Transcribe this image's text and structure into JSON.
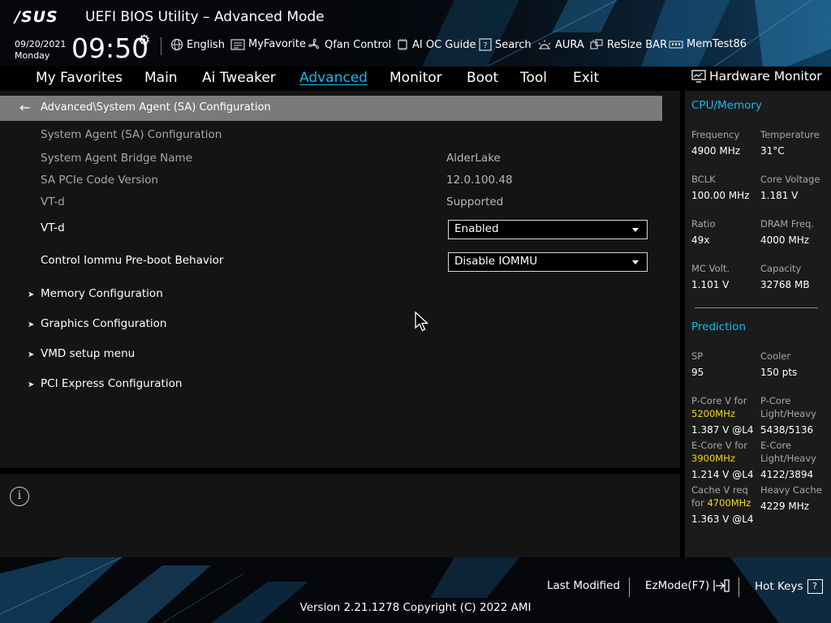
{
  "header": {
    "logo": "/SUS",
    "title": "UEFI BIOS Utility – Advanced Mode",
    "date": "09/20/2021",
    "day": "Monday",
    "time": "09:50",
    "tools": {
      "english": "English",
      "myfavorite": "MyFavorite",
      "qfan": "Qfan Control",
      "aioc": "AI OC Guide",
      "search": "Search",
      "aura": "AURA",
      "resizebar": "ReSize BAR",
      "memtest": "MemTest86"
    }
  },
  "tabs": {
    "favorites": "My Favorites",
    "main": "Main",
    "aitweaker": "Ai Tweaker",
    "advanced": "Advanced",
    "monitor": "Monitor",
    "boot": "Boot",
    "tool": "Tool",
    "exit": "Exit"
  },
  "breadcrumb": "Advanced\\System Agent (SA) Configuration",
  "content": {
    "section_title": "System Agent (SA) Configuration",
    "bridge_label": "System Agent Bridge Name",
    "bridge_value": "AlderLake",
    "pcie_label": "SA PCIe Code Version",
    "pcie_value": "12.0.100.48",
    "vtd_info_label": "VT-d",
    "vtd_info_value": "Supported",
    "vtd_label": "VT-d",
    "vtd_value": "Enabled",
    "iommu_label": "Control Iommu Pre-boot Behavior",
    "iommu_value": "Disable IOMMU",
    "submenus": {
      "memory": "Memory Configuration",
      "graphics": "Graphics Configuration",
      "vmd": "VMD setup menu",
      "pci": "PCI Express Configuration"
    }
  },
  "hw": {
    "title": "Hardware Monitor",
    "cpu_section": "CPU/Memory",
    "frequency_label": "Frequency",
    "frequency_value": "4900 MHz",
    "temperature_label": "Temperature",
    "temperature_value": "31°C",
    "bclk_label": "BCLK",
    "bclk_value": "100.00 MHz",
    "corevolt_label": "Core Voltage",
    "corevolt_value": "1.181 V",
    "ratio_label": "Ratio",
    "ratio_value": "49x",
    "dram_label": "DRAM Freq.",
    "dram_value": "4000 MHz",
    "mcvolt_label": "MC Volt.",
    "mcvolt_value": "1.101 V",
    "capacity_label": "Capacity",
    "capacity_value": "32768 MB",
    "prediction_section": "Prediction",
    "sp_label": "SP",
    "sp_value": "95",
    "cooler_label": "Cooler",
    "cooler_value": "150 pts",
    "pcorev_label": "P-Core V for",
    "pcorev_freq": "5200MHz",
    "pcorev_value": "1.387 V @L4",
    "pcorelh_label1": "P-Core",
    "pcorelh_label2": "Light/Heavy",
    "pcorelh_value": "5438/5136",
    "ecorev_label": "E-Core V for",
    "ecorev_freq": "3900MHz",
    "ecorev_value": "1.214 V @L4",
    "ecorelh_label1": "E-Core",
    "ecorelh_label2": "Light/Heavy",
    "ecorelh_value": "4122/3894",
    "cachev_label1": "Cache V req",
    "cachev_label2": "for",
    "cachev_freq": "4700MHz",
    "cachev_value": "1.363 V @L4",
    "heavycache_label": "Heavy Cache",
    "heavycache_value": "4229 MHz"
  },
  "footer": {
    "last_modified": "Last Modified",
    "ezmode": "EzMode(F7)",
    "hotkeys": "Hot Keys",
    "hotkeys_box": "?",
    "version": "Version 2.21.1278 Copyright (C) 2022 AMI"
  },
  "colors": {
    "accent": "#1ab7ea",
    "highlight": "#f5d90a",
    "breadcrumb_bg": "#7a7a7a"
  }
}
